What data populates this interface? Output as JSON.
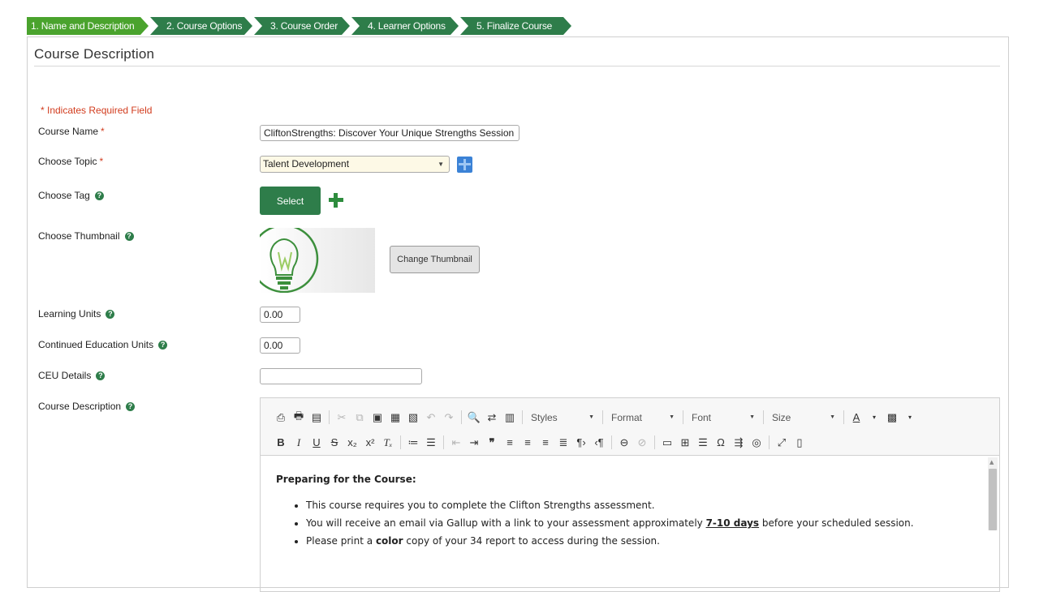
{
  "steps": [
    {
      "label": "1. Name and Description"
    },
    {
      "label": "2. Course Options"
    },
    {
      "label": "3. Course Order"
    },
    {
      "label": "4. Learner Options"
    },
    {
      "label": "5. Finalize Course"
    }
  ],
  "panel": {
    "title": "Course Description",
    "required_note": "* Indicates Required Field"
  },
  "form": {
    "course_name": {
      "label": "Course Name",
      "required": "*",
      "value": "CliftonStrengths: Discover Your Unique Strengths Session"
    },
    "topic": {
      "label": "Choose Topic",
      "required": "*",
      "value": "Talent Development"
    },
    "tag": {
      "label": "Choose Tag",
      "button": "Select"
    },
    "thumbnail": {
      "label": "Choose Thumbnail",
      "button": "Change Thumbnail"
    },
    "learning_units": {
      "label": "Learning Units",
      "value": "0.00"
    },
    "ceu": {
      "label": "Continued Education Units",
      "value": "0.00"
    },
    "ceu_details": {
      "label": "CEU Details",
      "value": ""
    },
    "description": {
      "label": "Course Description"
    }
  },
  "editor": {
    "combos": {
      "styles": "Styles",
      "format": "Format",
      "font": "Font",
      "size": "Size"
    },
    "heading": "Preparing for the Course:",
    "bullet1": "This course requires you to complete the Clifton Strengths assessment.",
    "bullet2_pre": "You will receive an email via Gallup with a link to your assessment approximately ",
    "bullet2_bold": "7-10 days",
    "bullet2_post": " before your scheduled session.",
    "bullet3_pre": "Please print a ",
    "bullet3_bold": "color",
    "bullet3_post": " copy of your 34 report to access during the session."
  },
  "colors": {
    "step_active": "#4aa32d",
    "step": "#2e7d4a",
    "required": "#d23c1e",
    "accent_blue": "#3b82d6"
  }
}
